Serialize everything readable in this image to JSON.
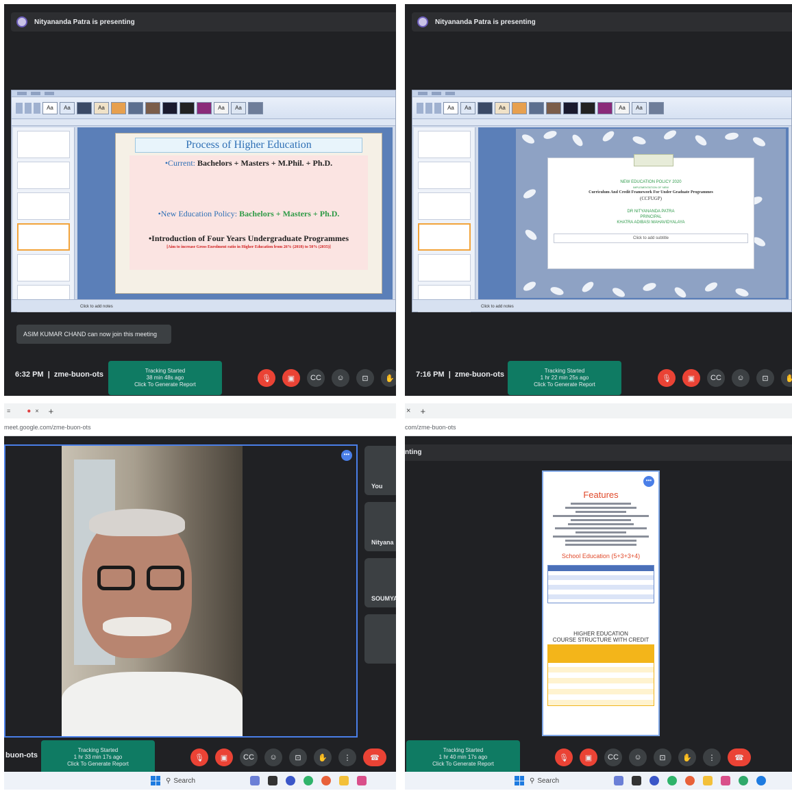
{
  "q1": {
    "presenter": "Nityananda Patra is presenting",
    "slide": {
      "title": "Process of Higher Education",
      "current_label": "Current:",
      "current_value": " Bachelors + Masters + M.Phil. + Ph.D.",
      "nep_label": "New Education Policy:",
      "nep_value": " Bachelors + Masters + Ph.D.",
      "intro": "Introduction of Four Years Undergraduate Programmes",
      "aim": "[Aim to increase Gross Enrolment ratio in Higher Education from 26% (2018) to 50% (2035)]"
    },
    "notes": "Click to add notes",
    "toast": "ASIM KUMAR CHAND can now join this meeting",
    "time": "6:32 PM",
    "meeting_code": "zme-buon-ots",
    "tracking": [
      "Tracking Started",
      "38 min 48s ago",
      "Click To Generate Report"
    ]
  },
  "q2": {
    "presenter": "Nityananda Patra is presenting",
    "slide": {
      "t1": "NEW EDUCATION POLICY 2020",
      "t2": "IMPLEMENTATION OF NEW",
      "t3": "Curriculum And Credit Framework For Under Graduate Programmes",
      "t4": "(CCFUGP)",
      "t5": "DR NITYANANDA PATRA",
      "t6": "PRINCIPAL",
      "t7": "KHATRA ADIBASI MAHAVIDYALAYA",
      "subtitle": "Click to add subtitle"
    },
    "notes": "Click to add notes",
    "time": "7:16 PM",
    "meeting_code": "zme-buon-ots",
    "tracking": [
      "Tracking Started",
      "1 hr 22 min 25s ago",
      "Click To Generate Report"
    ]
  },
  "q3": {
    "tab_new": "+",
    "url": "meet.google.com/zme-buon-ots",
    "participants": [
      "You",
      "Nityana",
      "SOUMYA"
    ],
    "meeting_code": "buon-ots",
    "tracking": [
      "Tracking Started",
      "1 hr 33 min 17s ago",
      "Click To Generate Report"
    ],
    "taskbar_search": "Search"
  },
  "q4": {
    "tab_close": "×",
    "tab_new": "+",
    "url": "com/zme-buon-ots",
    "presenting": "nting",
    "doc": {
      "heading": "Features",
      "school": "School Education (5+3+3+4)",
      "higher1": "HIGHER EDUCATION",
      "higher2": "COURSE STRUCTURE WITH CREDIT"
    },
    "tracking": [
      "Tracking Started",
      "1 hr 40 min 17s ago",
      "Click To Generate Report"
    ],
    "taskbar_search": "Search"
  },
  "icons": {
    "mic_off": "mic-off-icon",
    "cam_off": "camera-off-icon",
    "cc": "captions-icon",
    "emoji": "emoji-icon",
    "present": "present-screen-icon",
    "hand": "raise-hand-icon",
    "more": "more-vert-icon",
    "end": "end-call-icon"
  },
  "colors": {
    "meet_bg": "#202124",
    "tracking_green": "#0f7b63",
    "red": "#ea4335",
    "slide_blue": "#2e6fb5",
    "slide_green": "#2f9a46"
  }
}
